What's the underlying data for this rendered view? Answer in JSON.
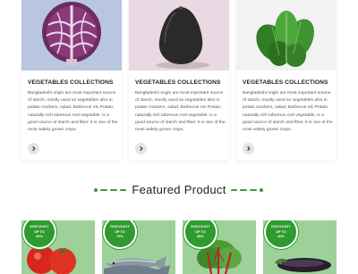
{
  "collections": [
    {
      "title": "VEGETABLES COLLECTIONS",
      "text": "Bangladeshi origin are most important source of starch, mostly used as vegetables also in potato crackers, salad, Barbecue etc.Potato, naturally rich tuberous root vegetable, is a good source of starch and fiber. It is one of the most widely grown crops.",
      "image": "red-cabbage-image"
    },
    {
      "title": "VEGETABLES COLLECTIONS",
      "text": "Bangladeshi origin are most important source of starch, mostly used as vegetables also in potato crackers, salad, Barbecue etc.Potato, naturally rich tuberous root vegetable, is a good source of starch and fiber. It is one of the most widely grown crops.",
      "image": "avocado-image"
    },
    {
      "title": "VEGETABLES COLLECTIONS",
      "text": "Bangladeshi origin are most important source of starch, mostly used as vegetables also in potato crackers, salad, Barbecue etc.Potato, naturally rich tuberous root vegetable, is a good source of starch and fiber. It is one of the most widely grown crops.",
      "image": "spinach-image"
    }
  ],
  "featured": {
    "title": "Featured Product",
    "products": [
      {
        "badge_line1": "DISCOUNT",
        "badge_line2": "UP TO",
        "badge_percent": "60%",
        "image": "tomatoes-image"
      },
      {
        "badge_line1": "DISCOUNT",
        "badge_line2": "UP TO",
        "badge_percent": "70%",
        "image": "fish-image"
      },
      {
        "badge_line1": "DISCOUNT",
        "badge_line2": "UP TO",
        "badge_percent": "80%",
        "image": "chard-image"
      },
      {
        "badge_line1": "DISCOUNT",
        "badge_line2": "UP TO",
        "badge_percent": "40%",
        "image": "eggplant-image"
      }
    ]
  },
  "colors": {
    "accent_green": "#2d9b2d",
    "tile_green": "#9ed19a",
    "card_bg_1": "#b8c6e0",
    "card_bg_2": "#e9d9e3",
    "card_bg_3": "#f2f2f2"
  },
  "icons": {
    "card_button": "chevron-right-icon",
    "heading_decoration": "dashed-line-ornament"
  }
}
